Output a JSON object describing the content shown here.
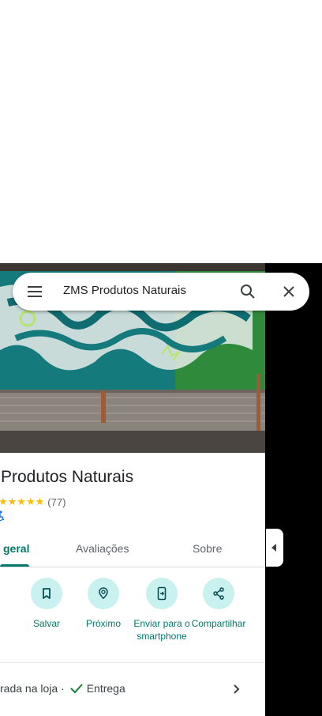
{
  "search": {
    "query": "ZMS Produtos Naturais",
    "menu_icon": "menu-icon",
    "search_icon": "search-icon",
    "close_icon": "close-icon"
  },
  "place": {
    "title": "Produtos Naturais",
    "stars": "★★★★★",
    "review_count": "(77)",
    "rating_color": "#fbbc04"
  },
  "tabs": [
    {
      "label": "geral",
      "active": true
    },
    {
      "label": "Avaliações",
      "active": false
    },
    {
      "label": "Sobre",
      "active": false
    }
  ],
  "actions": [
    {
      "label": "s",
      "icon": "directions-icon"
    },
    {
      "label": "Salvar",
      "icon": "bookmark-icon"
    },
    {
      "label": "Próximo",
      "icon": "nearby-icon"
    },
    {
      "label": "Enviar para o smartphone",
      "icon": "send-to-phone-icon"
    },
    {
      "label": "Compartilhar",
      "icon": "share-icon"
    }
  ],
  "service": {
    "text": "rada na loja ·",
    "delivery": "Entrega"
  },
  "colors": {
    "accent": "#00796b",
    "action_bg": "#c9f1ef"
  }
}
